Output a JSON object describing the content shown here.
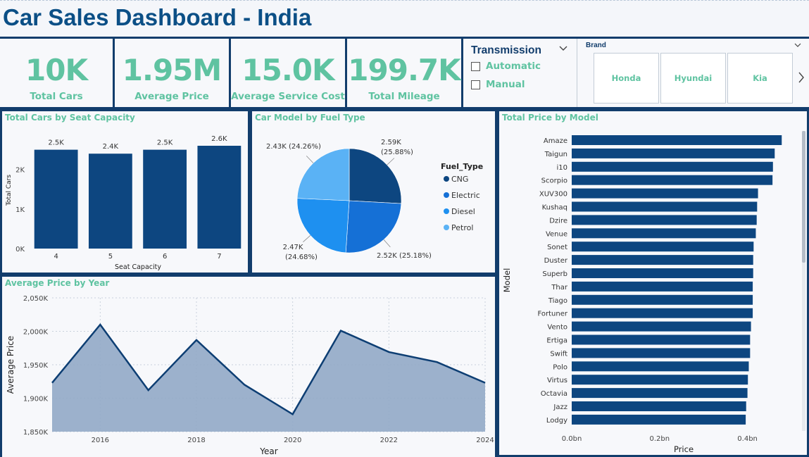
{
  "title": "Car Sales Dashboard - India",
  "kpis": [
    {
      "value": "10K",
      "label": "Total Cars"
    },
    {
      "value": "1.95M",
      "label": "Average Price"
    },
    {
      "value": "15.0K",
      "label": "Average Service Cost"
    },
    {
      "value": "199.7K",
      "label": "Total Mileage"
    }
  ],
  "transmission": {
    "title": "Transmission",
    "options": [
      "Automatic",
      "Manual"
    ]
  },
  "brand": {
    "title": "Brand",
    "tiles": [
      "Honda",
      "Hyundai",
      "Kia"
    ]
  },
  "panels": {
    "seat": "Total Cars by Seat Capacity",
    "fuel": "Car Model by Fuel Type",
    "model": "Total Price by Model",
    "year": "Average Price by Year"
  },
  "colors": {
    "primary": "#0d4680",
    "accent": "#5fc3a1",
    "cng": "#0d4680",
    "electric": "#1570d6",
    "diesel": "#1e90f0",
    "petrol": "#5ab2f5",
    "area": "#91a9c6"
  },
  "chart_data": [
    {
      "id": "seat",
      "type": "bar",
      "categories": [
        "4",
        "5",
        "6",
        "7"
      ],
      "values": [
        2500,
        2400,
        2500,
        2600
      ],
      "data_labels": [
        "2.5K",
        "2.4K",
        "2.5K",
        "2.6K"
      ],
      "xlabel": "Seat Capacity",
      "ylabel": "Total Cars",
      "ylim": [
        0,
        2600
      ],
      "yticks": [
        0,
        1000,
        2000
      ],
      "ytick_labels": [
        "0K",
        "1K",
        "2K"
      ]
    },
    {
      "id": "fuel",
      "type": "pie",
      "legend_title": "Fuel_Type",
      "legend_position": "right",
      "slices": [
        {
          "name": "CNG",
          "value": 2590,
          "label_value": "2.59K",
          "label_pct": "(25.88%)"
        },
        {
          "name": "Electric",
          "value": 2520,
          "label_value": "2.52K (25.18%)",
          "label_pct": ""
        },
        {
          "name": "Diesel",
          "value": 2470,
          "label_value": "2.47K",
          "label_pct": "(24.68%)"
        },
        {
          "name": "Petrol",
          "value": 2430,
          "label_value": "2.43K (24.26%)",
          "label_pct": ""
        }
      ]
    },
    {
      "id": "year",
      "type": "area",
      "x": [
        2015,
        2016,
        2017,
        2018,
        2019,
        2020,
        2021,
        2022,
        2023,
        2024
      ],
      "y": [
        1923000,
        2010000,
        1912000,
        1987000,
        1920000,
        1876000,
        2001000,
        1969000,
        1954000,
        1923000
      ],
      "xlabel": "Year",
      "ylabel": "Average Price",
      "xticks": [
        2016,
        2018,
        2020,
        2022,
        2024
      ],
      "xtick_labels": [
        "2016",
        "2018",
        "2020",
        "2022",
        "2024"
      ],
      "ylim": [
        1850000,
        2050000
      ],
      "yticks": [
        1850000,
        1900000,
        1950000,
        2000000,
        2050000
      ],
      "ytick_labels": [
        "1,850K",
        "1,900K",
        "1,950K",
        "2,000K",
        "2,050K"
      ],
      "grid": true
    },
    {
      "id": "model",
      "type": "bar",
      "orientation": "horizontal",
      "categories": [
        "Amaze",
        "Taigun",
        "i10",
        "Scorpio",
        "XUV300",
        "Kushaq",
        "Dzire",
        "Venue",
        "Sonet",
        "Duster",
        "Superb",
        "Thar",
        "Tiago",
        "Fortuner",
        "Vento",
        "Ertiga",
        "Swift",
        "Polo",
        "Virtus",
        "Octavia",
        "Jazz",
        "Lodgy"
      ],
      "values": [
        0.478,
        0.462,
        0.458,
        0.457,
        0.424,
        0.422,
        0.421,
        0.419,
        0.414,
        0.413,
        0.413,
        0.412,
        0.412,
        0.412,
        0.408,
        0.406,
        0.406,
        0.403,
        0.401,
        0.4,
        0.397,
        0.396
      ],
      "unit": "bn",
      "xlabel": "Price",
      "ylabel": "Model",
      "xlim": [
        0,
        0.5
      ],
      "xticks": [
        0,
        0.2,
        0.4
      ],
      "xtick_labels": [
        "0.0bn",
        "0.2bn",
        "0.4bn"
      ]
    }
  ]
}
